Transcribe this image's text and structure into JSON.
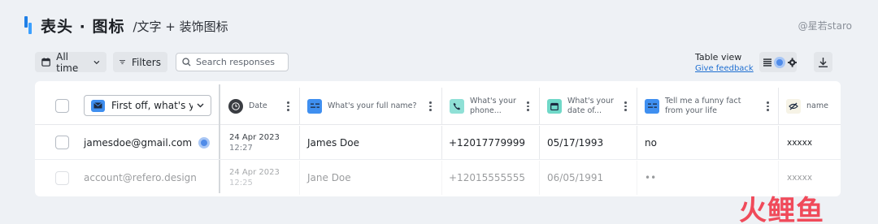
{
  "header": {
    "title": "表头 · 图标",
    "subtitle": "/文字 + 装饰图标",
    "credit": "@星若staro"
  },
  "toolbar": {
    "all_time": "All time",
    "filters": "Filters",
    "search_placeholder": "Search responses",
    "table_view": "Table view",
    "give_feedback": "Give feedback"
  },
  "table": {
    "first_column_select": "First off, what's your",
    "columns": [
      {
        "label": "Date",
        "icon": "clock-icon",
        "color": "#3a3d42"
      },
      {
        "label": "What's your full name?",
        "icon": "text-lines-icon",
        "color": "#3f8ff0"
      },
      {
        "label": "What's your phone...",
        "icon": "phone-icon",
        "color": "#8fe0d6"
      },
      {
        "label": "What's your date of...",
        "icon": "calendar-icon",
        "color": "#70d8c8"
      },
      {
        "label": "Tell me a funny fact from your life",
        "icon": "text-lines-icon",
        "color": "#3f8ff0"
      },
      {
        "label": "name",
        "icon": "eye-off-icon",
        "color": "#f6f3e6"
      }
    ],
    "rows": [
      {
        "email": "jamesdoe@gmail.com",
        "date": "24 Apr 2023",
        "time": "12:27",
        "name": "James Doe",
        "phone": "+12017779999",
        "dob": "05/17/1993",
        "fact": "no",
        "hidden": "xxxxx"
      },
      {
        "email": "account@refero.design",
        "date": "24 Apr 2023",
        "time": "12:25",
        "name": "Jane Doe",
        "phone": "+12015555555",
        "dob": "06/05/1991",
        "fact": "••",
        "hidden": "xxxxx"
      }
    ]
  },
  "watermark": {
    "c1": "火",
    "c2": "鲤",
    "c3": "鱼"
  },
  "colors": {
    "accent": "#1f6fd1",
    "brand_blue": "#3ba0ff",
    "watermark": "#f04a5a"
  }
}
